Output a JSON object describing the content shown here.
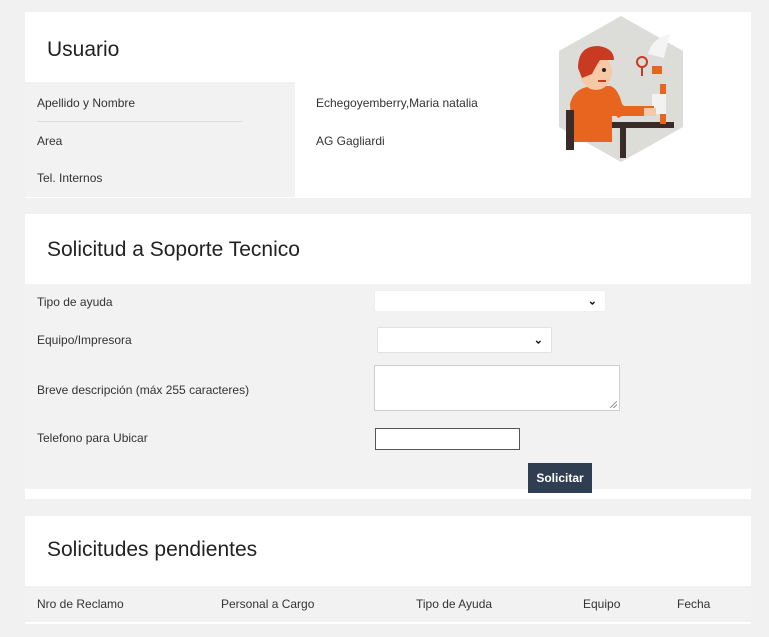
{
  "usuario": {
    "title": "Usuario",
    "rows": [
      {
        "label": "Apellido y Nombre",
        "value": "Echegoyemberry,Maria natalia"
      },
      {
        "label": "Area",
        "value": "AG Gagliardi"
      },
      {
        "label": "Tel. Internos",
        "value": ""
      }
    ],
    "avatar_icon": "support-person-illustration"
  },
  "solicitud": {
    "title": "Solicitud a Soporte Tecnico",
    "tipo_label": "Tipo de ayuda",
    "tipo_value": "",
    "equipo_label": "Equipo/Impresora",
    "equipo_value": "",
    "descripcion_label": "Breve descripción (máx 255 caracteres)",
    "descripcion_value": "",
    "telefono_label": "Telefono para Ubicar",
    "telefono_value": "",
    "submit_label": "Solicitar"
  },
  "pendientes": {
    "title": "Solicitudes pendientes",
    "columns": [
      "Nro de Reclamo",
      "Personal a Cargo",
      "Tipo de Ayuda",
      "Equipo",
      "Fecha"
    ]
  },
  "colors": {
    "button": "#2f3e50",
    "orange": "#e8651f",
    "hexagon": "#dcddd8"
  }
}
